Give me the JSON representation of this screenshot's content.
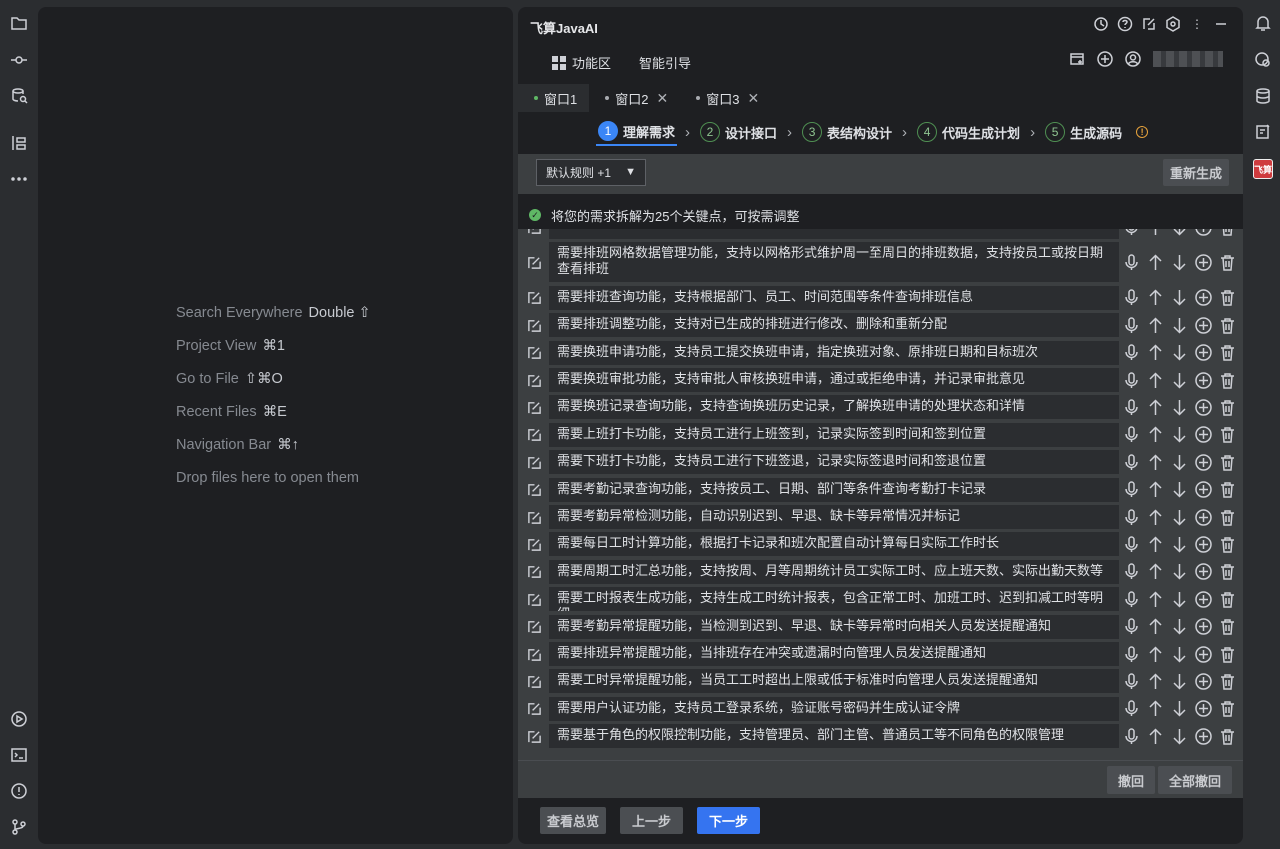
{
  "left_sidebar": {
    "icons": [
      "folder-icon",
      "commit-icon",
      "database-search-icon",
      "structure-icon",
      "more-icon",
      "run-icon",
      "terminal-icon",
      "problems-icon",
      "git-branch-icon"
    ]
  },
  "editor": {
    "hints": [
      {
        "label": "Search Everywhere",
        "shortcut": "Double ⇧"
      },
      {
        "label": "Project View",
        "shortcut": "⌘1"
      },
      {
        "label": "Go to File",
        "shortcut": "⇧⌘O"
      },
      {
        "label": "Recent Files",
        "shortcut": "⌘E"
      },
      {
        "label": "Navigation Bar",
        "shortcut": "⌘↑"
      },
      {
        "label": "Drop files here to open them",
        "shortcut": ""
      }
    ]
  },
  "panel": {
    "title": "飞算JavaAI",
    "menu": {
      "features": "功能区",
      "guide": "智能引导"
    },
    "tabs": [
      {
        "label": "窗口1"
      },
      {
        "label": "窗口2"
      },
      {
        "label": "窗口3"
      }
    ],
    "steps": [
      {
        "num": "1",
        "label": "理解需求"
      },
      {
        "num": "2",
        "label": "设计接口"
      },
      {
        "num": "3",
        "label": "表结构设计"
      },
      {
        "num": "4",
        "label": "代码生成计划"
      },
      {
        "num": "5",
        "label": "生成源码"
      }
    ],
    "rule_select": "默认规则 +1",
    "regenerate": "重新生成",
    "status": "将您的需求拆解为25个关键点，可按需调整",
    "items": [
      "需要排班网格数据管理功能，支持以网格形式维护周一至周日的排班数据，支持按员工或按日期查看排班",
      "需要排班查询功能，支持根据部门、员工、时间范围等条件查询排班信息",
      "需要排班调整功能，支持对已生成的排班进行修改、删除和重新分配",
      "需要换班申请功能，支持员工提交换班申请，指定换班对象、原排班日期和目标班次",
      "需要换班审批功能，支持审批人审核换班申请，通过或拒绝申请，并记录审批意见",
      "需要换班记录查询功能，支持查询换班历史记录，了解换班申请的处理状态和详情",
      "需要上班打卡功能，支持员工进行上班签到，记录实际签到时间和签到位置",
      "需要下班打卡功能，支持员工进行下班签退，记录实际签退时间和签退位置",
      "需要考勤记录查询功能，支持按员工、日期、部门等条件查询考勤打卡记录",
      "需要考勤异常检测功能，自动识别迟到、早退、缺卡等异常情况并标记",
      "需要每日工时计算功能，根据打卡记录和班次配置自动计算每日实际工作时长",
      "需要周期工时汇总功能，支持按周、月等周期统计员工实际工时、应上班天数、实际出勤天数等",
      "需要工时报表生成功能，支持生成工时统计报表，包含正常工时、加班工时、迟到扣减工时等明细",
      "需要考勤异常提醒功能，当检测到迟到、早退、缺卡等异常时向相关人员发送提醒通知",
      "需要排班异常提醒功能，当排班存在冲突或遗漏时向管理人员发送提醒通知",
      "需要工时异常提醒功能，当员工工时超出上限或低于标准时向管理人员发送提醒通知",
      "需要用户认证功能，支持员工登录系统，验证账号密码并生成认证令牌",
      "需要基于角色的权限控制功能，支持管理员、部门主管、普通员工等不同角色的权限管理"
    ],
    "undo": "撤回",
    "undo_all": "全部撤回",
    "overview": "查看总览",
    "prev": "上一步",
    "next": "下一步"
  },
  "right_sidebar": {
    "icons": [
      "notifications-icon",
      "ai-chat-icon",
      "database-icon",
      "ai-assistant-icon",
      "feisuan-icon"
    ],
    "feisuan_label": "飞算"
  }
}
